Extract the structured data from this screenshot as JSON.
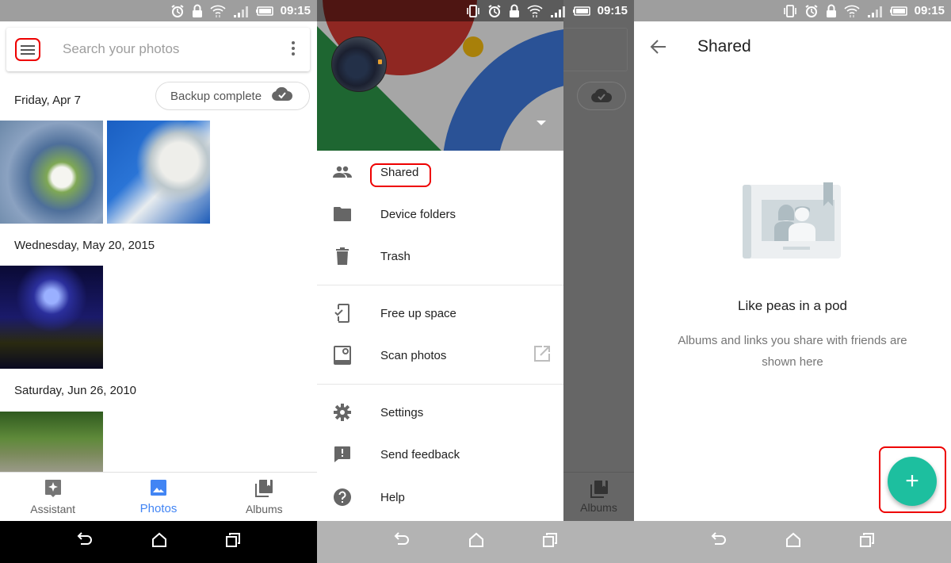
{
  "status_bar": {
    "time": "09:15"
  },
  "screen1": {
    "search": {
      "placeholder": "Search your photos"
    },
    "backup_status": "Backup complete",
    "sections": [
      {
        "date": "Friday, Apr 7",
        "photos": [
          "white cherry blossom close-up",
          "cherry blossom branches against blue sky"
        ]
      },
      {
        "date": "Wednesday, May 20, 2015",
        "photos": [
          "PC case interior with blue lighting"
        ]
      },
      {
        "date": "Saturday, Jun 26, 2010",
        "photos": [
          "wooden path through green forest"
        ]
      }
    ],
    "bottom_nav": [
      {
        "label": "Assistant",
        "icon": "assistant-icon",
        "active": false
      },
      {
        "label": "Photos",
        "icon": "photos-icon",
        "active": true
      },
      {
        "label": "Albums",
        "icon": "albums-icon",
        "active": false
      }
    ]
  },
  "screen2": {
    "drawer_items": [
      {
        "label": "Shared",
        "icon": "people-icon",
        "highlighted": true
      },
      {
        "label": "Device folders",
        "icon": "folder-icon"
      },
      {
        "label": "Trash",
        "icon": "trash-icon"
      },
      {
        "label": "Free up space",
        "icon": "phone-check-icon"
      },
      {
        "label": "Scan photos",
        "icon": "scan-photo-icon",
        "external": true
      },
      {
        "label": "Settings",
        "icon": "gear-icon"
      },
      {
        "label": "Send feedback",
        "icon": "feedback-icon"
      },
      {
        "label": "Help",
        "icon": "help-icon"
      }
    ],
    "background_nav_label": "Albums"
  },
  "screen3": {
    "title": "Shared",
    "empty_title": "Like peas in a pod",
    "empty_description": "Albums and links you share with friends are shown here",
    "fab_label": "+"
  },
  "colors": {
    "accent_blue": "#4285f4",
    "fab_teal": "#1dbf9f",
    "highlight_red": "#ee0000",
    "status_bar_grey": "#9e9e9e"
  }
}
